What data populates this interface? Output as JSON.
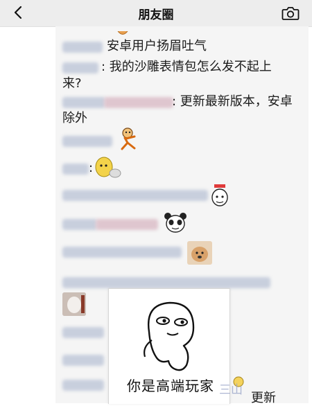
{
  "nav": {
    "title": "朋友圈",
    "back_icon": "chevron-left-icon",
    "camera_icon": "camera-icon"
  },
  "comments": [
    {
      "text": "安卓用户扬眉吐气"
    },
    {
      "text_line1": ": 我的沙雕表情包怎么发不起上",
      "text_line2": "来?"
    },
    {
      "text_line1": ": 更新最新版本，安卓",
      "text_line2": "除外"
    }
  ],
  "sticker_popup": {
    "caption": "你是高端玩家"
  },
  "watermark": "三山",
  "trailing_text": "更新"
}
